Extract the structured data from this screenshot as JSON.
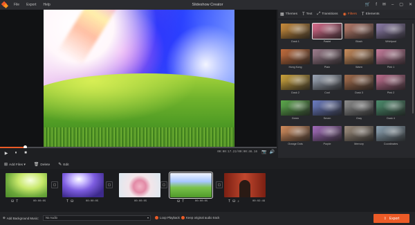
{
  "app": {
    "title": "Slideshow Creator"
  },
  "menu": [
    "File",
    "Export",
    "Help"
  ],
  "window_controls": {
    "cart": "🛒",
    "facebook": "f",
    "message": "✉",
    "min": "–",
    "max": "▢",
    "close": "✕"
  },
  "player": {
    "progress": 0.09,
    "play": "▶",
    "pause": "⏸",
    "stop": "■",
    "timecode": "00:00:17.22/00:00:46.16",
    "snapshot": "📷",
    "volume": "🔊"
  },
  "tabs": [
    {
      "label": "Themes",
      "icon": "▦",
      "active": false
    },
    {
      "label": "Text",
      "icon": "T",
      "active": false
    },
    {
      "label": "Transitions",
      "icon": "⤢",
      "active": false
    },
    {
      "label": "Filters",
      "icon": "◉",
      "active": true
    },
    {
      "label": "Elements",
      "icon": "T",
      "active": false
    }
  ],
  "filters": [
    {
      "label": "Dusk 1",
      "color": "#c98b3a"
    },
    {
      "label": "Pastel",
      "color": "#d86a8a",
      "selected": true
    },
    {
      "label": "Blush",
      "color": "#b77a6a"
    },
    {
      "label": "Whirlpool",
      "color": "#8a7aa6"
    },
    {
      "label": "Hong Kong",
      "color": "#c06a3a"
    },
    {
      "label": "Plain",
      "color": "#9a7a8a"
    },
    {
      "label": "Warm",
      "color": "#c78a5a"
    },
    {
      "label": "Pink 1",
      "color": "#c47a9a"
    },
    {
      "label": "Dusk 2",
      "color": "#c9a03a"
    },
    {
      "label": "Cool",
      "color": "#9aa4b4"
    },
    {
      "label": "Dusk 3",
      "color": "#a06a4a"
    },
    {
      "label": "Pink 2",
      "color": "#b86a8a"
    },
    {
      "label": "Green",
      "color": "#5aa64a"
    },
    {
      "label": "Seven",
      "color": "#6a7ac0"
    },
    {
      "label": "Gray",
      "color": "#8a8a8a"
    },
    {
      "label": "Dusk 4",
      "color": "#4a8a6a"
    },
    {
      "label": "Orange Dots",
      "color": "#d08a5a"
    },
    {
      "label": "Purple",
      "color": "#a06ab8"
    },
    {
      "label": "Memory",
      "color": "#9a8a7a"
    },
    {
      "label": "Coordinates",
      "color": "#8aa0b0"
    }
  ],
  "editbar": {
    "add_files": "Add Files",
    "delete": "Delete",
    "edit": "Edit"
  },
  "clips": [
    {
      "duration": "00:00:05"
    },
    {
      "duration": "00:00:05"
    },
    {
      "duration": "00:00:05"
    },
    {
      "duration": "00:00:05"
    },
    {
      "duration": "00:02:49"
    }
  ],
  "bottom": {
    "add_music": "Add Background Music:",
    "music_value": "No Audio",
    "loop": "Loop Playback",
    "keep_audio": "Keep original audio track",
    "export": "Export"
  },
  "colors": {
    "accent": "#ec5b27"
  }
}
